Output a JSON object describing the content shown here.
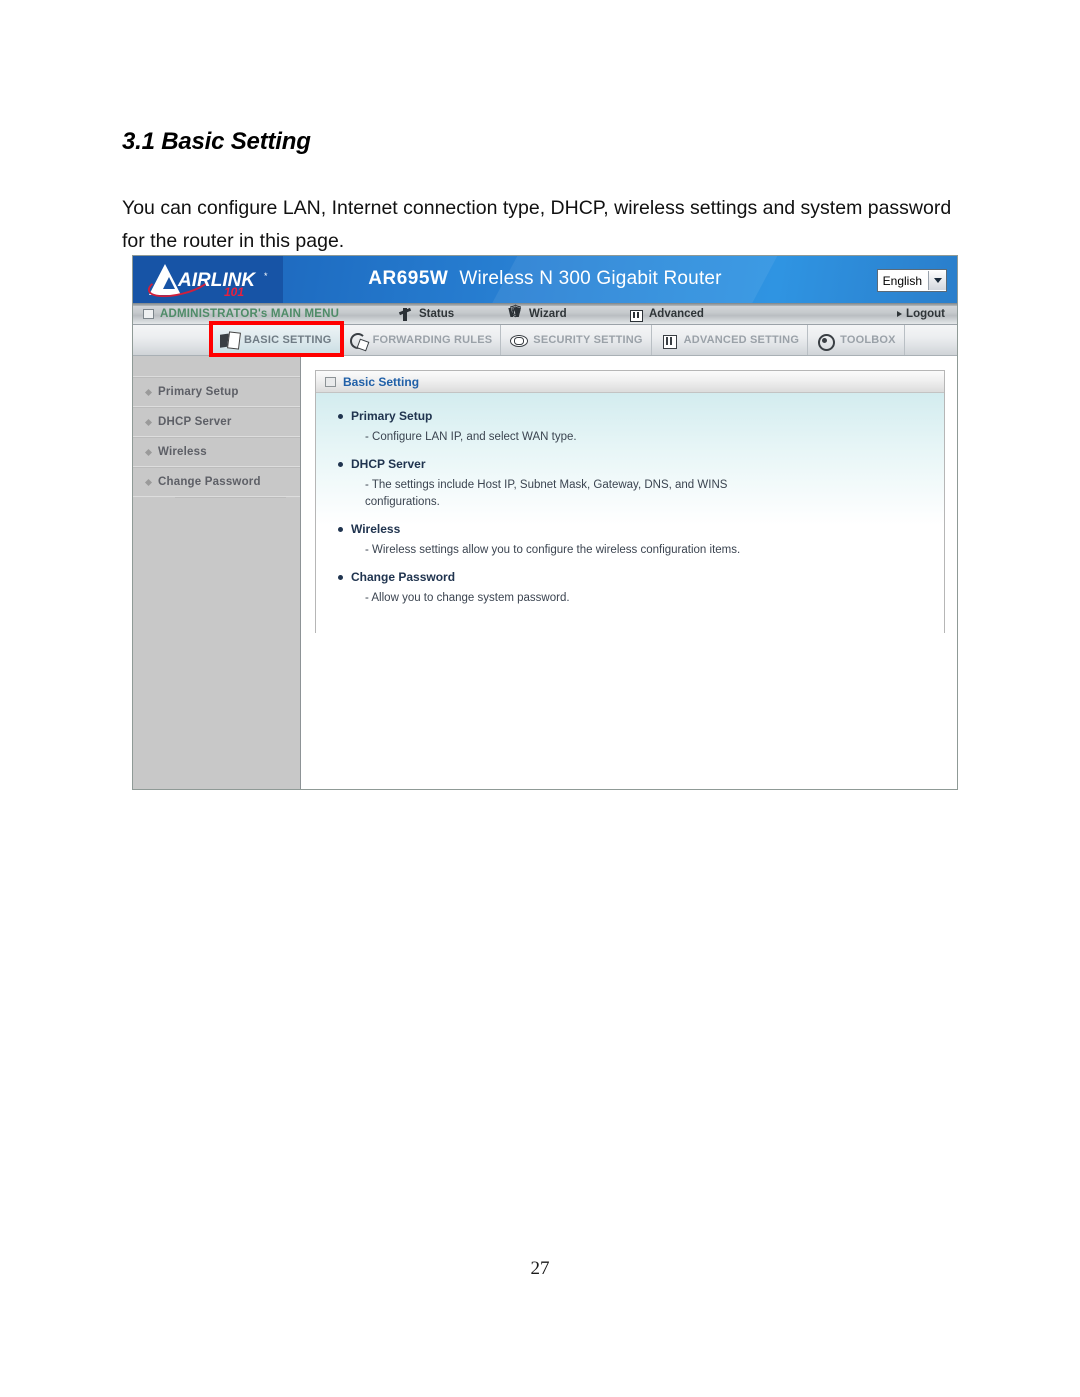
{
  "document": {
    "heading": "3.1 Basic Setting",
    "paragraph": "You can configure LAN, Internet connection type, DHCP, wireless settings and system password for the router in this page.",
    "page_number": "27"
  },
  "router_ui": {
    "banner": {
      "logo_text": "AIRLINK",
      "logo_text_small": "IRL",
      "logo_suffix": "101",
      "logo_trademark": "*",
      "model": "AR695W",
      "product_name": "Wireless N 300 Gigabit Router",
      "language": {
        "selected": "English",
        "options": [
          "English"
        ]
      }
    },
    "menu_strip": {
      "admin_label": "ADMINISTRATOR's MAIN MENU",
      "items": [
        {
          "label": "Status",
          "icon": "status-icon"
        },
        {
          "label": "Wizard",
          "icon": "wizard-icon"
        },
        {
          "label": "Advanced",
          "icon": "advanced-icon"
        }
      ],
      "logout_label": "Logout"
    },
    "tabs": [
      {
        "label": "BASIC SETTING",
        "icon": "documents-icon",
        "active": true
      },
      {
        "label": "FORWARDING RULES",
        "icon": "arrows-icon",
        "active": false
      },
      {
        "label": "SECURITY SETTING",
        "icon": "shield-icon",
        "active": false
      },
      {
        "label": "ADVANCED SETTING",
        "icon": "box-arrow-icon",
        "active": false
      },
      {
        "label": "TOOLBOX",
        "icon": "gear-icon",
        "active": false
      }
    ],
    "sidebar": {
      "items": [
        {
          "label": "Primary Setup"
        },
        {
          "label": "DHCP Server"
        },
        {
          "label": "Wireless"
        },
        {
          "label": "Change Password"
        }
      ]
    },
    "panel": {
      "title": "Basic Setting",
      "entries": [
        {
          "title": "Primary Setup",
          "description": "- Configure LAN IP, and select WAN type."
        },
        {
          "title": "DHCP Server",
          "description": "- The settings include Host IP, Subnet Mask, Gateway, DNS, and WINS configurations."
        },
        {
          "title": "Wireless",
          "description": "- Wireless settings allow you to configure the wireless configuration items."
        },
        {
          "title": "Change Password",
          "description": "- Allow you to change system password."
        }
      ]
    },
    "colors": {
      "banner_blue": "#2b86d8",
      "logo_red": "#e8203d",
      "admin_green": "#4f8c68",
      "panel_title_blue": "#2060a8",
      "highlight_red": "#ff0000",
      "sidebar_gray": "#c8c8c8"
    }
  }
}
